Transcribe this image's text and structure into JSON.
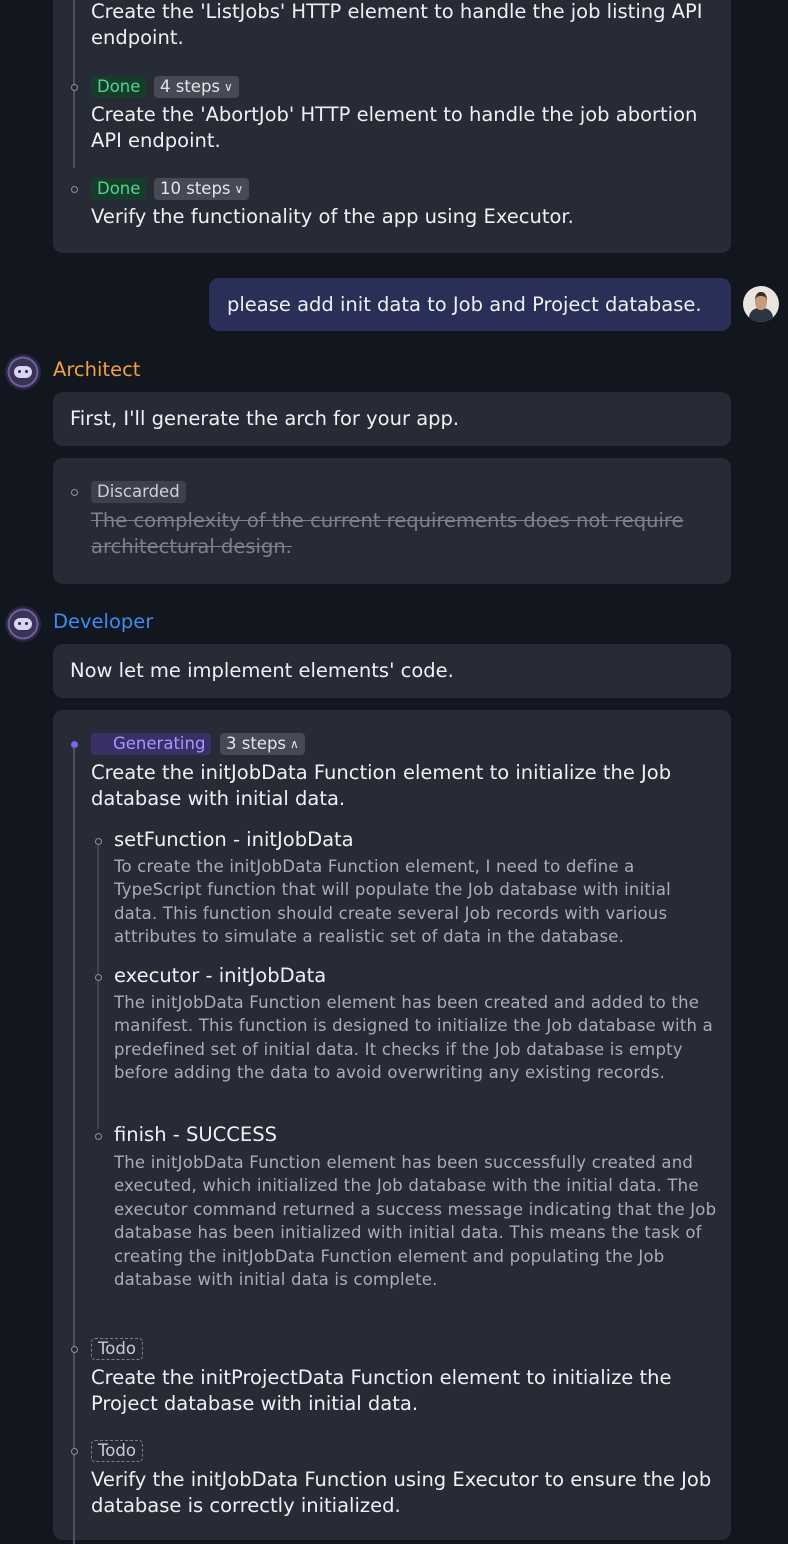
{
  "top_card": {
    "partial_step_text": "Create the 'ListJobs' HTTP element to handle the job listing API endpoint.",
    "steps": [
      {
        "status": "Done",
        "steps_label": "4 steps",
        "text": "Create the 'AbortJob' HTTP element to handle the job abortion API endpoint."
      },
      {
        "status": "Done",
        "steps_label": "10 steps",
        "text": "Verify the functionality of the app using Executor."
      }
    ]
  },
  "user_message": {
    "text": "please add init data to Job and Project database."
  },
  "architect": {
    "role": "Architect",
    "message": "First, I'll generate the arch for your app.",
    "plan": {
      "status": "Discarded",
      "text": "The complexity of the current requirements does not require architectural design."
    }
  },
  "developer": {
    "role": "Developer",
    "message": "Now let me implement elements' code.",
    "plan": {
      "current": {
        "status": "Generating",
        "steps_label": "3 steps",
        "text": "Create the initJobData Function element to initialize the Job database with initial data.",
        "substeps": [
          {
            "title": "setFunction - initJobData",
            "desc": "To create the initJobData Function element, I need to define a TypeScript function that will populate the Job database with initial data. This function should create several Job records with various attributes to simulate a realistic set of data in the database."
          },
          {
            "title": "executor - initJobData",
            "desc": "The initJobData Function element has been created and added to the manifest. This function is designed to initialize the Job database with a predefined set of initial data. It checks if the Job database is empty before adding the data to avoid overwriting any existing records."
          },
          {
            "title": "finish - SUCCESS",
            "desc": "The initJobData Function element has been successfully created and executed, which initialized the Job database with the initial data. The executor command returned a success message indicating that the Job database has been initialized with initial data. This means the task of creating the initJobData Function element and populating the Job database with initial data is complete."
          }
        ]
      },
      "todos": [
        {
          "status": "Todo",
          "text": "Create the initProjectData Function element to initialize the Project database with initial data."
        },
        {
          "status": "Todo",
          "text": "Verify the initJobData Function using Executor to ensure the Job database is correctly initialized."
        }
      ]
    }
  },
  "colors": {
    "background": "#12161e",
    "card": "#262b35",
    "user_bubble": "#2a2f58",
    "architect": "#f2a23c",
    "developer": "#3d8cf0",
    "done": "#4fd68a",
    "generating": "#a995ff"
  },
  "icons": {
    "bot_avatar": "robot-avatar-icon",
    "user_avatar": "user-photo-avatar",
    "chevron_down": "chevron-down-icon",
    "chevron_up": "chevron-up-icon"
  }
}
